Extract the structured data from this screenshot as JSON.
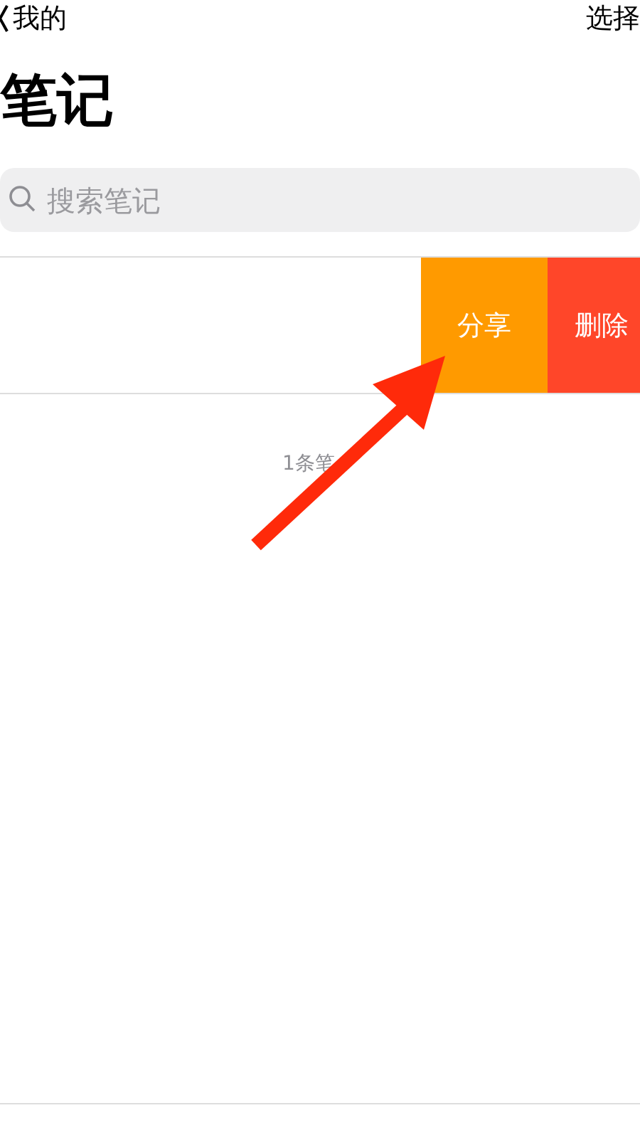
{
  "nav": {
    "back_label": "我的",
    "action": "选择"
  },
  "title": "笔记",
  "search": {
    "placeholder": "搜索笔记"
  },
  "row_actions": [
    {
      "label": "分享",
      "kind": "share"
    },
    {
      "label": "删除",
      "kind": "delete"
    }
  ],
  "note_count": "1条笔"
}
